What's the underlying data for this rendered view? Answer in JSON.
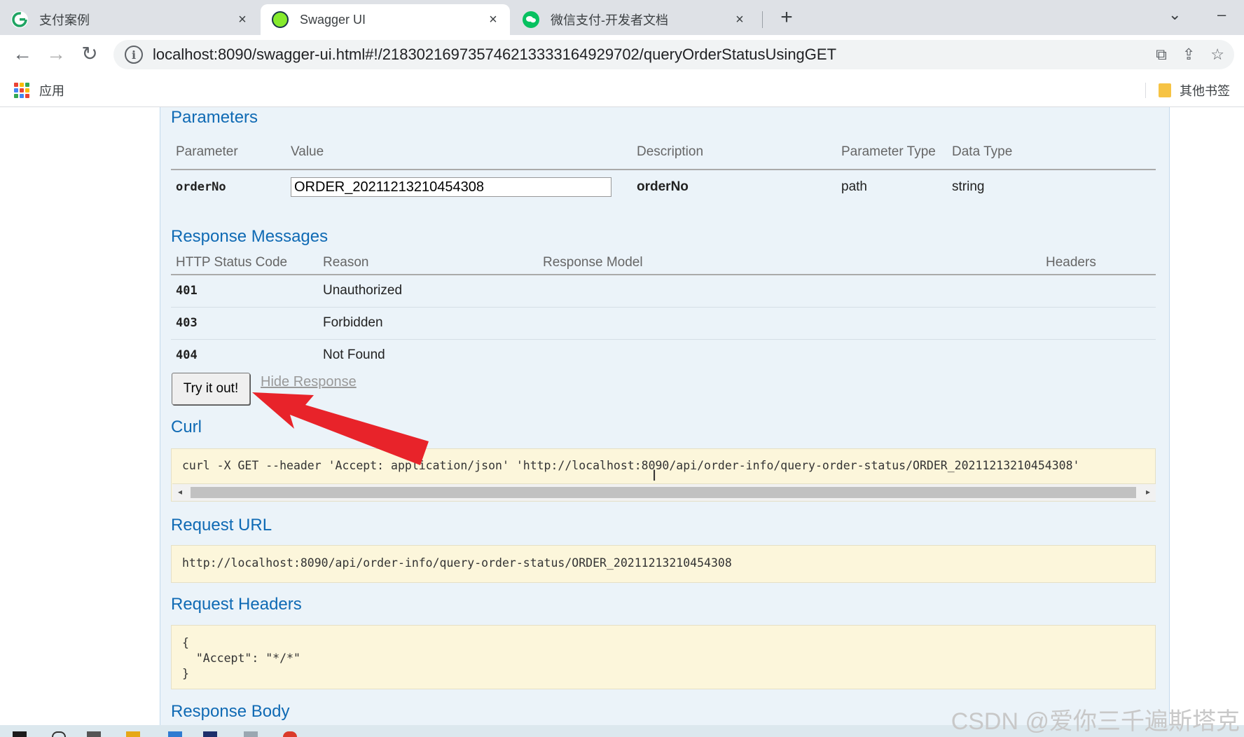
{
  "browser": {
    "tabs": [
      {
        "title": "支付案例",
        "close": "×"
      },
      {
        "title": "Swagger UI",
        "close": "×"
      },
      {
        "title": "微信支付-开发者文档",
        "close": "×"
      }
    ],
    "new_tab": "+",
    "url": "localhost:8090/swagger-ui.html#!/218302169735746213333164929702/queryOrderStatusUsingGET",
    "bookmarks": {
      "apps": "应用",
      "other": "其他书签"
    }
  },
  "parameters": {
    "title": "Parameters",
    "headers": {
      "parameter": "Parameter",
      "value": "Value",
      "description": "Description",
      "parameter_type": "Parameter Type",
      "data_type": "Data Type"
    },
    "row": {
      "name": "orderNo",
      "value": "ORDER_20211213210454308",
      "description": "orderNo",
      "type": "path",
      "data_type": "string"
    }
  },
  "responses": {
    "title": "Response Messages",
    "headers": {
      "code": "HTTP Status Code",
      "reason": "Reason",
      "model": "Response Model",
      "headers": "Headers"
    },
    "rows": [
      {
        "code": "401",
        "reason": "Unauthorized"
      },
      {
        "code": "403",
        "reason": "Forbidden"
      },
      {
        "code": "404",
        "reason": "Not Found"
      }
    ]
  },
  "actions": {
    "try": "Try it out!",
    "hide": "Hide Response"
  },
  "curl": {
    "title": "Curl",
    "command": "curl -X GET --header 'Accept: application/json' 'http://localhost:8090/api/order-info/query-order-status/ORDER_20211213210454308'"
  },
  "request_url": {
    "title": "Request URL",
    "value": "http://localhost:8090/api/order-info/query-order-status/ORDER_20211213210454308"
  },
  "request_headers": {
    "title": "Request Headers",
    "value": "{\n  \"Accept\": \"*/*\"\n}"
  },
  "response_body": {
    "title": "Response Body"
  },
  "watermark": "CSDN @爱你三千遍斯塔克",
  "colors": {
    "section_title": "#0f6ab4",
    "panel_bg": "#ebf3f9",
    "code_bg": "#fcf6db",
    "arrow": "#e8232a"
  }
}
